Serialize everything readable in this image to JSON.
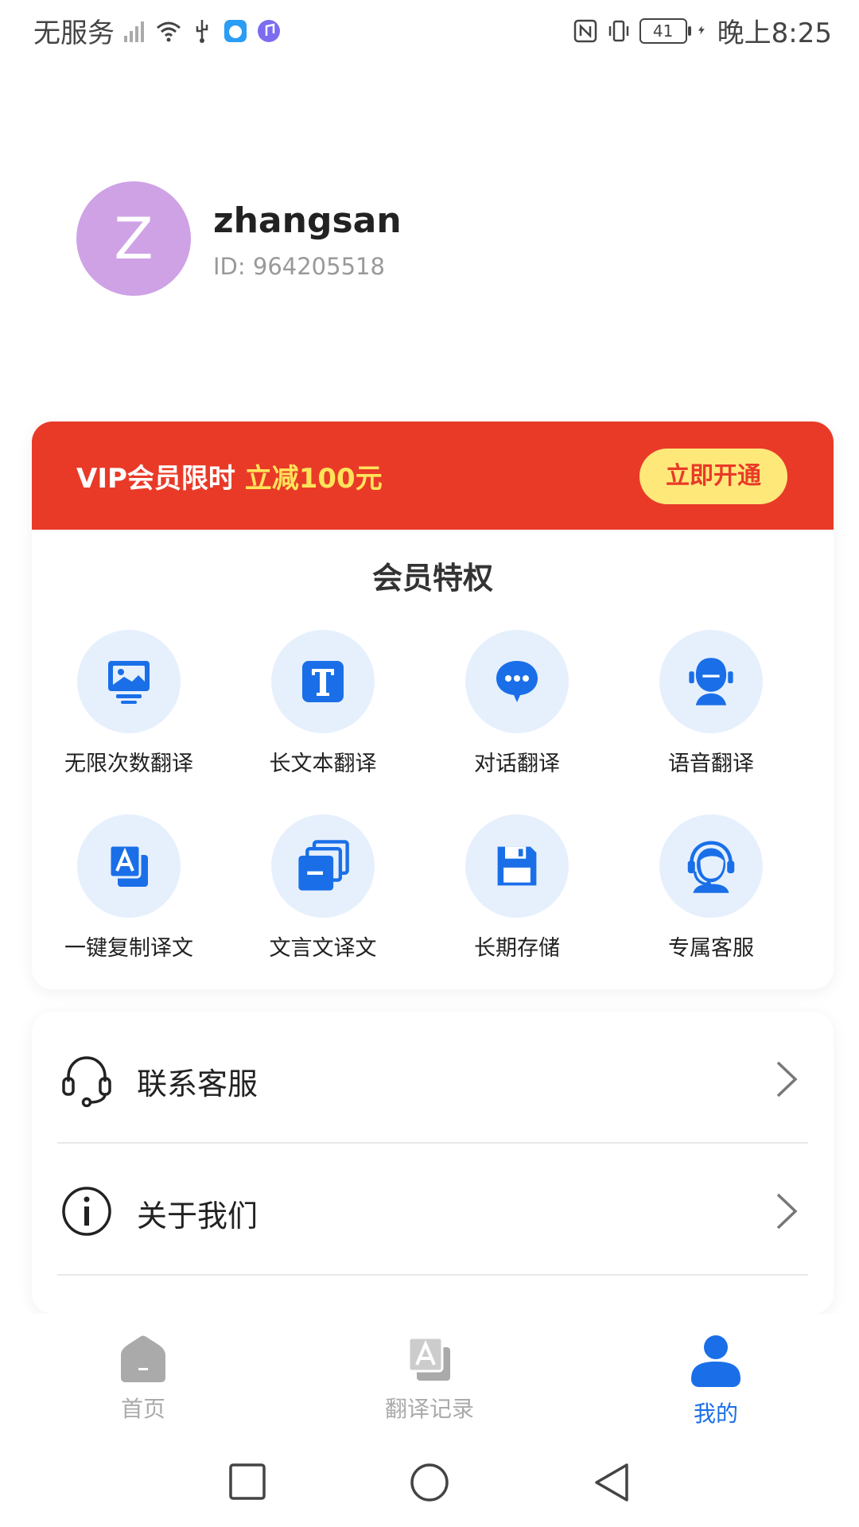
{
  "status_bar": {
    "carrier": "无服务",
    "battery": "41",
    "time": "晚上8:25"
  },
  "profile": {
    "avatar_letter": "Z",
    "username": "zhangsan",
    "user_id": "ID: 964205518"
  },
  "vip": {
    "banner_text": "VIP会员限时 ",
    "banner_highlight": "立减100元",
    "open_button": "立即开通",
    "privileges_title": "会员特权",
    "privileges": [
      {
        "label": "无限次数翻译",
        "icon": "image-translate-icon"
      },
      {
        "label": "长文本翻译",
        "icon": "text-t-icon"
      },
      {
        "label": "对话翻译",
        "icon": "chat-bubble-icon"
      },
      {
        "label": "语音翻译",
        "icon": "voice-person-icon"
      },
      {
        "label": "一键复制译文",
        "icon": "copy-translate-icon"
      },
      {
        "label": "文言文译文",
        "icon": "stacked-docs-icon"
      },
      {
        "label": "长期存储",
        "icon": "floppy-disk-icon"
      },
      {
        "label": "专属客服",
        "icon": "headset-agent-icon"
      }
    ]
  },
  "menu": {
    "items": [
      {
        "label": "联系客服",
        "icon": "headset-icon"
      },
      {
        "label": "关于我们",
        "icon": "info-icon"
      }
    ]
  },
  "bottom_nav": {
    "items": [
      {
        "label": "首页",
        "icon": "home-icon",
        "active": false
      },
      {
        "label": "翻译记录",
        "icon": "translate-record-icon",
        "active": false
      },
      {
        "label": "我的",
        "icon": "profile-icon",
        "active": true
      }
    ]
  },
  "colors": {
    "accent": "#1a6fe8",
    "vip_red": "#e93a28",
    "vip_yellow": "#ffe35a",
    "avatar": "#cfa2e6",
    "icon_bg": "#e6f0fd"
  }
}
